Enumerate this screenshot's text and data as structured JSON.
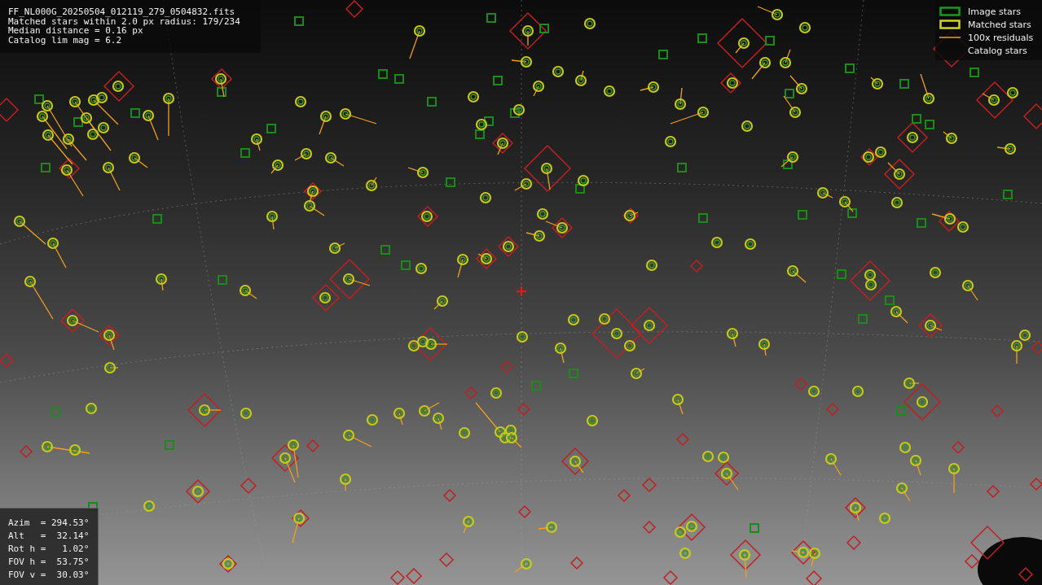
{
  "header": {
    "lines": [
      "FF_NL000G_20250504_012119_279_0504832.fits",
      "Matched stars within 2.0 px radius: 179/234",
      "Median distance = 0.16 px",
      "Catalog lim mag = 6.2"
    ]
  },
  "legend": {
    "items": [
      {
        "label": "Image stars",
        "kind": "image"
      },
      {
        "label": "Matched stars",
        "kind": "matched"
      },
      {
        "label": "100x residuals",
        "kind": "residual"
      },
      {
        "label": "Catalog stars",
        "kind": "catalog"
      }
    ]
  },
  "pointing": {
    "lines": [
      "Azim  = 294.53°",
      "Alt   =  32.14°",
      "Rot h =   1.02°",
      "FOV h =  53.75°",
      "FOV v =  30.03°"
    ]
  }
}
